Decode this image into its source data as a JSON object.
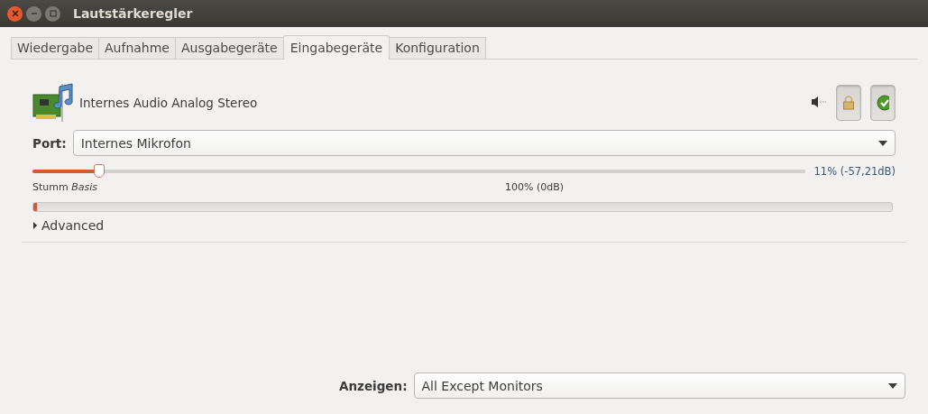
{
  "window": {
    "title": "Lautstärkeregler"
  },
  "tabs": [
    {
      "label": "Wiedergabe",
      "selected": false
    },
    {
      "label": "Aufnahme",
      "selected": false
    },
    {
      "label": "Ausgabegeräte",
      "selected": false
    },
    {
      "label": "Eingabegeräte",
      "selected": true
    },
    {
      "label": "Konfiguration",
      "selected": false
    }
  ],
  "devices": [
    {
      "name": "Internes Audio Analog Stereo",
      "muted": false,
      "lock_on": true,
      "default_on": true,
      "port_label": "Port:",
      "port": "Internes Mikrofon",
      "volume": {
        "level": 0.08,
        "reading": "11% (-57,21dB)",
        "mark_mute": "Stumm",
        "mark_base": "Basis",
        "mark_100": "100% (0dB)"
      },
      "meter": {
        "level": 0.004
      },
      "advanced": {
        "label": "Advanced",
        "expanded": false
      }
    }
  ],
  "footer": {
    "label": "Anzeigen:",
    "value": "All Except Monitors"
  }
}
